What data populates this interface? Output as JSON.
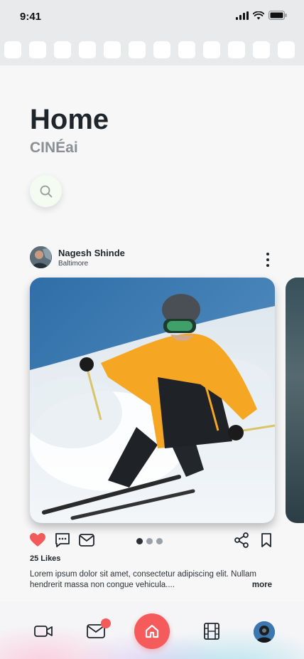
{
  "status_bar": {
    "time": "9:41",
    "icons": [
      "signal-icon",
      "wifi-icon",
      "battery-icon"
    ]
  },
  "stories": {
    "count": 12
  },
  "header": {
    "title": "Home",
    "subtitle": "CINÉai"
  },
  "search": {
    "icon": "search-icon"
  },
  "post": {
    "author": "Nagesh Shinde",
    "location": "Baltimore",
    "image_description_icon": "skier-photo",
    "likes": "25 Likes",
    "caption": "Lorem ipsum dolor sit amet, consectetur adipiscing elit. Nullam hendrerit massa non congue vehicula....",
    "more_label": "more",
    "carousel_active": 0,
    "carousel_total": 3
  },
  "tabbar": {
    "items": [
      "video-icon",
      "mail-icon",
      "home-icon",
      "film-icon",
      "profile-avatar"
    ],
    "mail_has_badge": true
  },
  "colors": {
    "accent": "#f55b5b",
    "like": "#f35b5b",
    "text": "#1f262b"
  }
}
